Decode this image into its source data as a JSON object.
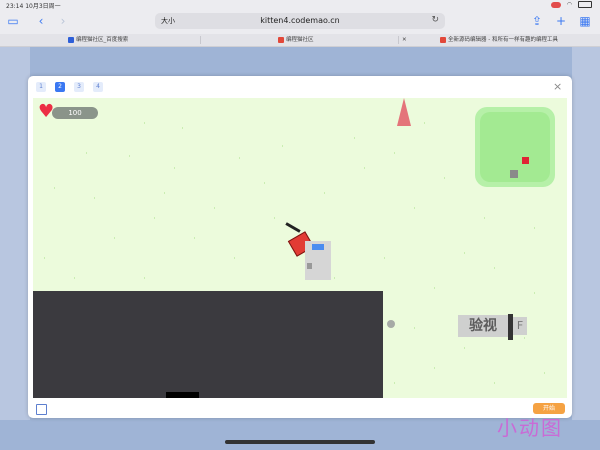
{
  "status_bar": {
    "time": "23:14",
    "date": "10月3日周一",
    "icon": "orientation-lock-icon"
  },
  "toolbar": {
    "url_aa": "大小",
    "url": "kitten4.codemao.cn",
    "lock_icon": "lock-icon"
  },
  "tabs": [
    {
      "label": "编程猫社区_百度搜索",
      "icon": "baidu-icon",
      "color": "#2e5fd8"
    },
    {
      "label": "编程猫社区",
      "icon": "codemao-icon",
      "color": "#e2483a"
    },
    {
      "label": "",
      "icon": "close-tab-icon",
      "color": "#555555"
    },
    {
      "label": "全新源码编辑器 - 和所有一样有趣的编程工具",
      "icon": "kitten-icon",
      "color": "#e2483a"
    }
  ],
  "modal": {
    "scene_buttons": [
      "1",
      "2",
      "3",
      "4"
    ],
    "active_scene": "2",
    "close_label": "×"
  },
  "game": {
    "health": "100",
    "sign_text": "验视",
    "sign_key": "F"
  },
  "footer": {
    "run_label": "开始"
  },
  "watermark": "小动图",
  "colors": {
    "accent": "#3a78f2",
    "grass": "#ecfbdc",
    "heart": "#ec2e45",
    "wall": "#3b3a3f"
  }
}
